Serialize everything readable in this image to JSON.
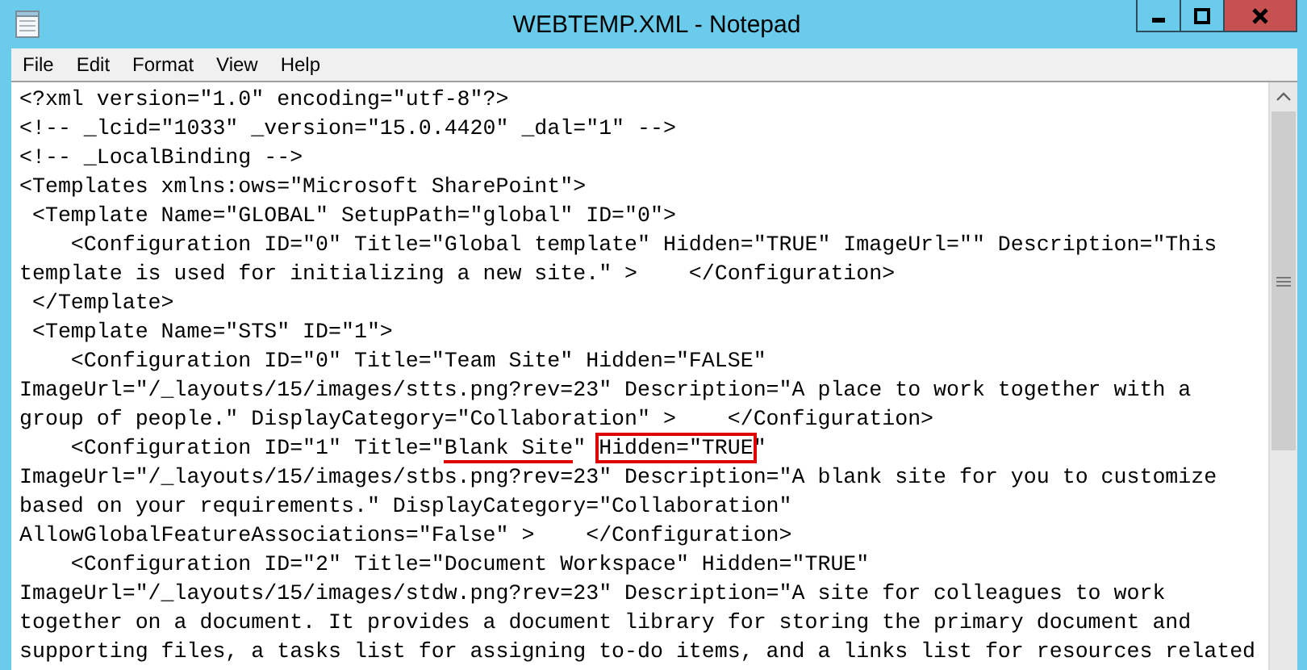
{
  "window": {
    "title": "WEBTEMP.XML - Notepad"
  },
  "menu": [
    "File",
    "Edit",
    "Format",
    "View",
    "Help"
  ],
  "editor": {
    "lines": [
      [
        {
          "text": "<?xml version=\"1.0\" encoding=\"utf-8\"?>"
        }
      ],
      [
        {
          "text": "<!-- _lcid=\"1033\" _version=\"15.0.4420\" _dal=\"1\" -->"
        }
      ],
      [
        {
          "text": "<!-- _LocalBinding -->"
        }
      ],
      [
        {
          "text": "<Templates xmlns:ows=\"Microsoft SharePoint\">"
        }
      ],
      [
        {
          "text": " <Template Name=\"GLOBAL\" SetupPath=\"global\" ID=\"0\">"
        }
      ],
      [
        {
          "text": "    <Configuration ID=\"0\" Title=\"Global template\" Hidden=\"TRUE\" ImageUrl=\"\" Description=\"This"
        }
      ],
      [
        {
          "text": "template is used for initializing a new site.\" >    </Configuration>"
        }
      ],
      [
        {
          "text": " </Template>"
        }
      ],
      [
        {
          "text": " <Template Name=\"STS\" ID=\"1\">"
        }
      ],
      [
        {
          "text": "    <Configuration ID=\"0\" Title=\"Team Site\" Hidden=\"FALSE\""
        }
      ],
      [
        {
          "text": "ImageUrl=\"/_layouts/15/images/stts.png?rev=23\" Description=\"A place to work together with a"
        }
      ],
      [
        {
          "text": "group of people.\" DisplayCategory=\"Collaboration\" >    </Configuration>"
        }
      ],
      [
        {
          "text": "    <Configuration ID=\"1\" Title=\""
        },
        {
          "text": "Blank Site",
          "underlined": true
        },
        {
          "text": "\" "
        },
        {
          "text": "Hidden=\"TRUE",
          "boxed": true
        },
        {
          "text": "\""
        }
      ],
      [
        {
          "text": "ImageUrl=\"/_layouts/15/images/stbs.png?rev=23\" Description=\"A blank site for you to customize"
        }
      ],
      [
        {
          "text": "based on your requirements.\" DisplayCategory=\"Collaboration\""
        }
      ],
      [
        {
          "text": "AllowGlobalFeatureAssociations=\"False\" >    </Configuration>"
        }
      ],
      [
        {
          "text": "    <Configuration ID=\"2\" Title=\"Document Workspace\" Hidden=\"TRUE\""
        }
      ],
      [
        {
          "text": "ImageUrl=\"/_layouts/15/images/stdw.png?rev=23\" Description=\"A site for colleagues to work"
        }
      ],
      [
        {
          "text": "together on a document. It provides a document library for storing the primary document and"
        }
      ],
      [
        {
          "text": "supporting files, a tasks list for assigning to-do items, and a links list for resources related"
        }
      ]
    ]
  }
}
